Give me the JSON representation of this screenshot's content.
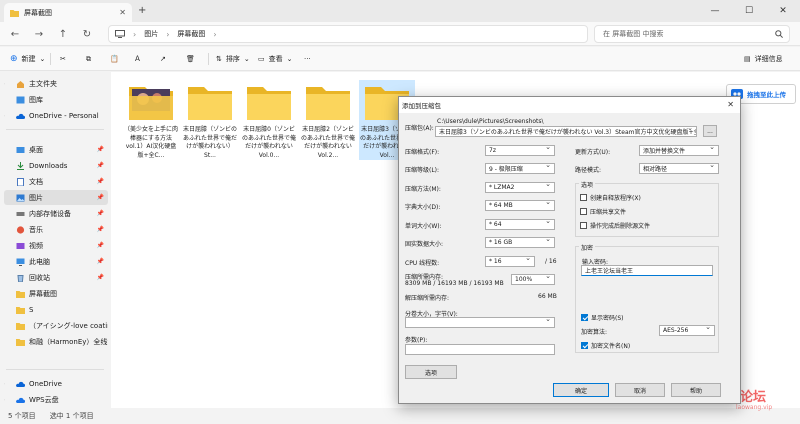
{
  "window": {
    "tab_title": "屏幕截图",
    "minimize": "—",
    "maximize": "☐",
    "close": "✕"
  },
  "navigation": {
    "breadcrumb": [
      "图片",
      "屏幕截图"
    ],
    "search_placeholder": "在 屏幕截图 中搜索"
  },
  "toolbar": {
    "new_label": "新建",
    "sort_label": "排序",
    "view_label": "查看",
    "details_label": "详细信息"
  },
  "sidebar": {
    "items": [
      {
        "label": "主文件夹"
      },
      {
        "label": "图库"
      },
      {
        "label": "OneDrive - Personal"
      },
      {
        "label": "桌面"
      },
      {
        "label": "Downloads"
      },
      {
        "label": "文档"
      },
      {
        "label": "图片"
      },
      {
        "label": "内部存储设备"
      },
      {
        "label": "音乐"
      },
      {
        "label": "视频"
      },
      {
        "label": "此电脑"
      },
      {
        "label": "回收站"
      },
      {
        "label": "屏幕截图"
      },
      {
        "label": "S"
      },
      {
        "label": "（アイシング-love coating"
      },
      {
        "label": "和融（HarmonEy）全线汉"
      },
      {
        "label": "OneDrive"
      },
      {
        "label": "WPS云盘"
      }
    ]
  },
  "files": [
    {
      "name": "（美少女を上手に肉棒器にする方法 vol.1）AI汉化硬盘版+全C..."
    },
    {
      "name": "末日屈膝（ゾンビのあふれた世界で俺だけが襲われない）St..."
    },
    {
      "name": "末日屈膝0（ゾンビのあふれた世界で俺だけが襲われない Vol.0..."
    },
    {
      "name": "末日屈膝2（ゾンビのあふれた世界で俺だけが襲われない Vol.2..."
    },
    {
      "name": "末日屈膝3（ゾンビのあふれた世界で俺だけが襲われない Vol..."
    }
  ],
  "cloud_button": "拖拽至此上传",
  "background_hint": "此",
  "status": {
    "count": "5 个项目",
    "selected": "选中 1 个项目"
  },
  "watermark": {
    "text": "老王论坛",
    "url": "laowang.vip"
  },
  "dialog": {
    "title": "添加到压缩包",
    "archive_name_label": "压缩包(A):",
    "archive_path": "C:\\Users\\dule\\Pictures\\Screenshots\\",
    "archive_name": "末日屈膝3（ゾンビのあふれた世界で俺だけが襲われない Vol.3）Steam官方中文优化硬盘版+全CG",
    "browse_button": "...",
    "left_fields": [
      {
        "label": "压缩格式(F):",
        "value": "7z"
      },
      {
        "label": "压缩等级(L):",
        "value": "9 - 极限压缩"
      },
      {
        "label": "压缩方法(M):",
        "value": "* LZMA2"
      },
      {
        "label": "字典大小(D):",
        "value": "* 64 MB"
      },
      {
        "label": "单词大小(W):",
        "value": "* 64"
      },
      {
        "label": "固实数据大小:",
        "value": "* 16 GB"
      }
    ],
    "cpu_label": "CPU 线程数:",
    "cpu_value": "* 16",
    "cpu_total": "/ 16",
    "memory_label": "压缩所需内存:",
    "memory_detail": "8309 MB / 16193 MB / 16193 MB",
    "memory_percent": "100%",
    "decompress_mem_label": "解压缩所需内存:",
    "decompress_mem_value": "66 MB",
    "split_label": "分卷大小，字节(V):",
    "params_label": "参数(P):",
    "options_button": "选项",
    "update_mode_label": "更新方式(U):",
    "update_mode_value": "添加并替换文件",
    "path_mode_label": "路径模式:",
    "path_mode_value": "相对路径",
    "options_group": "选项",
    "checkboxes": [
      {
        "label": "创建自释放程序(X)",
        "checked": false
      },
      {
        "label": "压缩共享文件",
        "checked": false
      },
      {
        "label": "操作完成后删除源文件",
        "checked": false
      }
    ],
    "encryption_group": "加密",
    "password_label": "输入密码:",
    "password_value": "上老王论坛当老王",
    "show_password": {
      "label": "显示密码(S)",
      "checked": true
    },
    "encryption_method_label": "加密算法:",
    "encryption_method_value": "AES-256",
    "encrypt_names": {
      "label": "加密文件名(N)",
      "checked": true
    },
    "ok_button": "确定",
    "cancel_button": "取消",
    "help_button": "帮助",
    "close_symbol": "✕"
  }
}
